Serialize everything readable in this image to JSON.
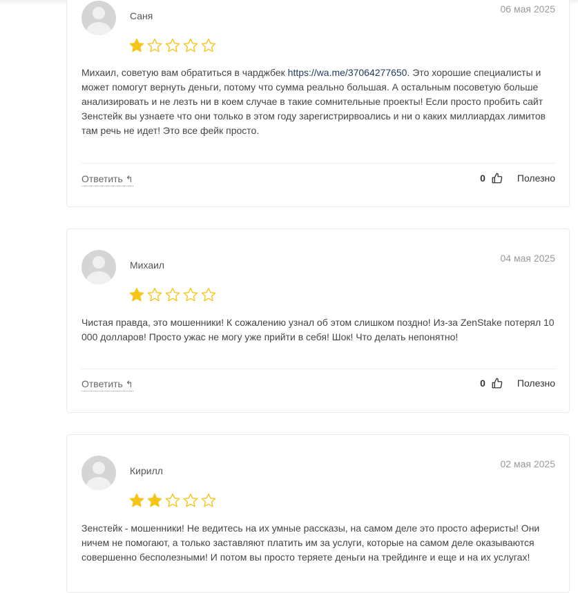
{
  "colors": {
    "star_filled": "#f5c518",
    "star_empty_stroke": "#f5c518",
    "link": "#1e3a5f"
  },
  "reviews": [
    {
      "author": "Саня",
      "date": "06 мая 2025",
      "rating": 1,
      "text_before_link": "Михаил, советую вам обратиться в чарджбек ",
      "link": "https://wa.me/37064277650",
      "text_after_link": ". Это хорошие специалисты и может помогут вернуть деньги, потому что сумма реально большая. А остальным посоветую больше анализировать и не лезть ни в коем случае в такие сомнительные проекты! Если просто пробить сайт Зенстейк вы узнаете что они только в этом году зарегистрирвоались и ни о каких миллиардах лимитов там речь не идет! Это все фейк просто.",
      "reply_label": "Ответить",
      "vote_count": "0",
      "useful_label": "Полезно"
    },
    {
      "author": "Михаил",
      "date": "04 мая 2025",
      "rating": 1,
      "text": "Чистая правда, это мошенники! К сожалению узнал об этом слишком поздно! Из-за ZenStake потерял 10 000 долларов! Просто ужас не могу уже прийти в себя! Шок! Что делать непонятно!",
      "reply_label": "Ответить",
      "vote_count": "0",
      "useful_label": "Полезно"
    },
    {
      "author": "Кирилл",
      "date": "02 мая 2025",
      "rating": 2,
      "text": "Зенстейк - мошенники! Не ведитесь на их умные рассказы, на самом деле это просто аферисты! Они ничем не помогают, а только заставляют платить им за услуги, которые на самом деле оказываются совершенно бесполезными! И потом вы просто теряете деньги на трейдинге и еще и на их услугах!"
    }
  ]
}
